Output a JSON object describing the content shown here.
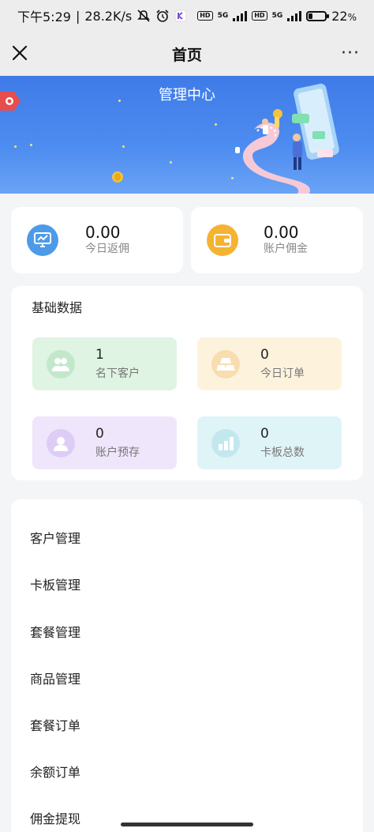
{
  "status_bar": {
    "time": "下午5:29",
    "speed": "28.2K/s",
    "battery": "22",
    "battery_unit": "%",
    "hd1": "HD",
    "hd2": "HD",
    "net1": "5G",
    "net2": "5G"
  },
  "navbar": {
    "title": "首页",
    "more": "···"
  },
  "banner": {
    "title": "管理中心"
  },
  "stats": [
    {
      "value": "0.00",
      "label": "今日返佣",
      "icon": "monitor-chart-icon",
      "color": "#4d9be8"
    },
    {
      "value": "0.00",
      "label": "账户佣金",
      "icon": "wallet-icon",
      "color": "#f5b332"
    }
  ],
  "basic_data": {
    "title": "基础数据",
    "tiles": [
      {
        "value": "1",
        "label": "名下客户",
        "icon": "users-icon",
        "bg": "#dff4e3",
        "icon_bg": "#c2e8cb"
      },
      {
        "value": "0",
        "label": "今日订单",
        "icon": "gold-bars-icon",
        "bg": "#fdf3dd",
        "icon_bg": "#f7ddb0"
      },
      {
        "value": "0",
        "label": "账户预存",
        "icon": "user-avatar-icon",
        "bg": "#efe6fb",
        "icon_bg": "#ddcdf6"
      },
      {
        "value": "0",
        "label": "卡板总数",
        "icon": "bar-chart-icon",
        "bg": "#dff4f6",
        "icon_bg": "#c2e8ee"
      }
    ]
  },
  "menu": [
    "客户管理",
    "卡板管理",
    "套餐管理",
    "商品管理",
    "套餐订单",
    "余额订单",
    "佣金提现"
  ]
}
